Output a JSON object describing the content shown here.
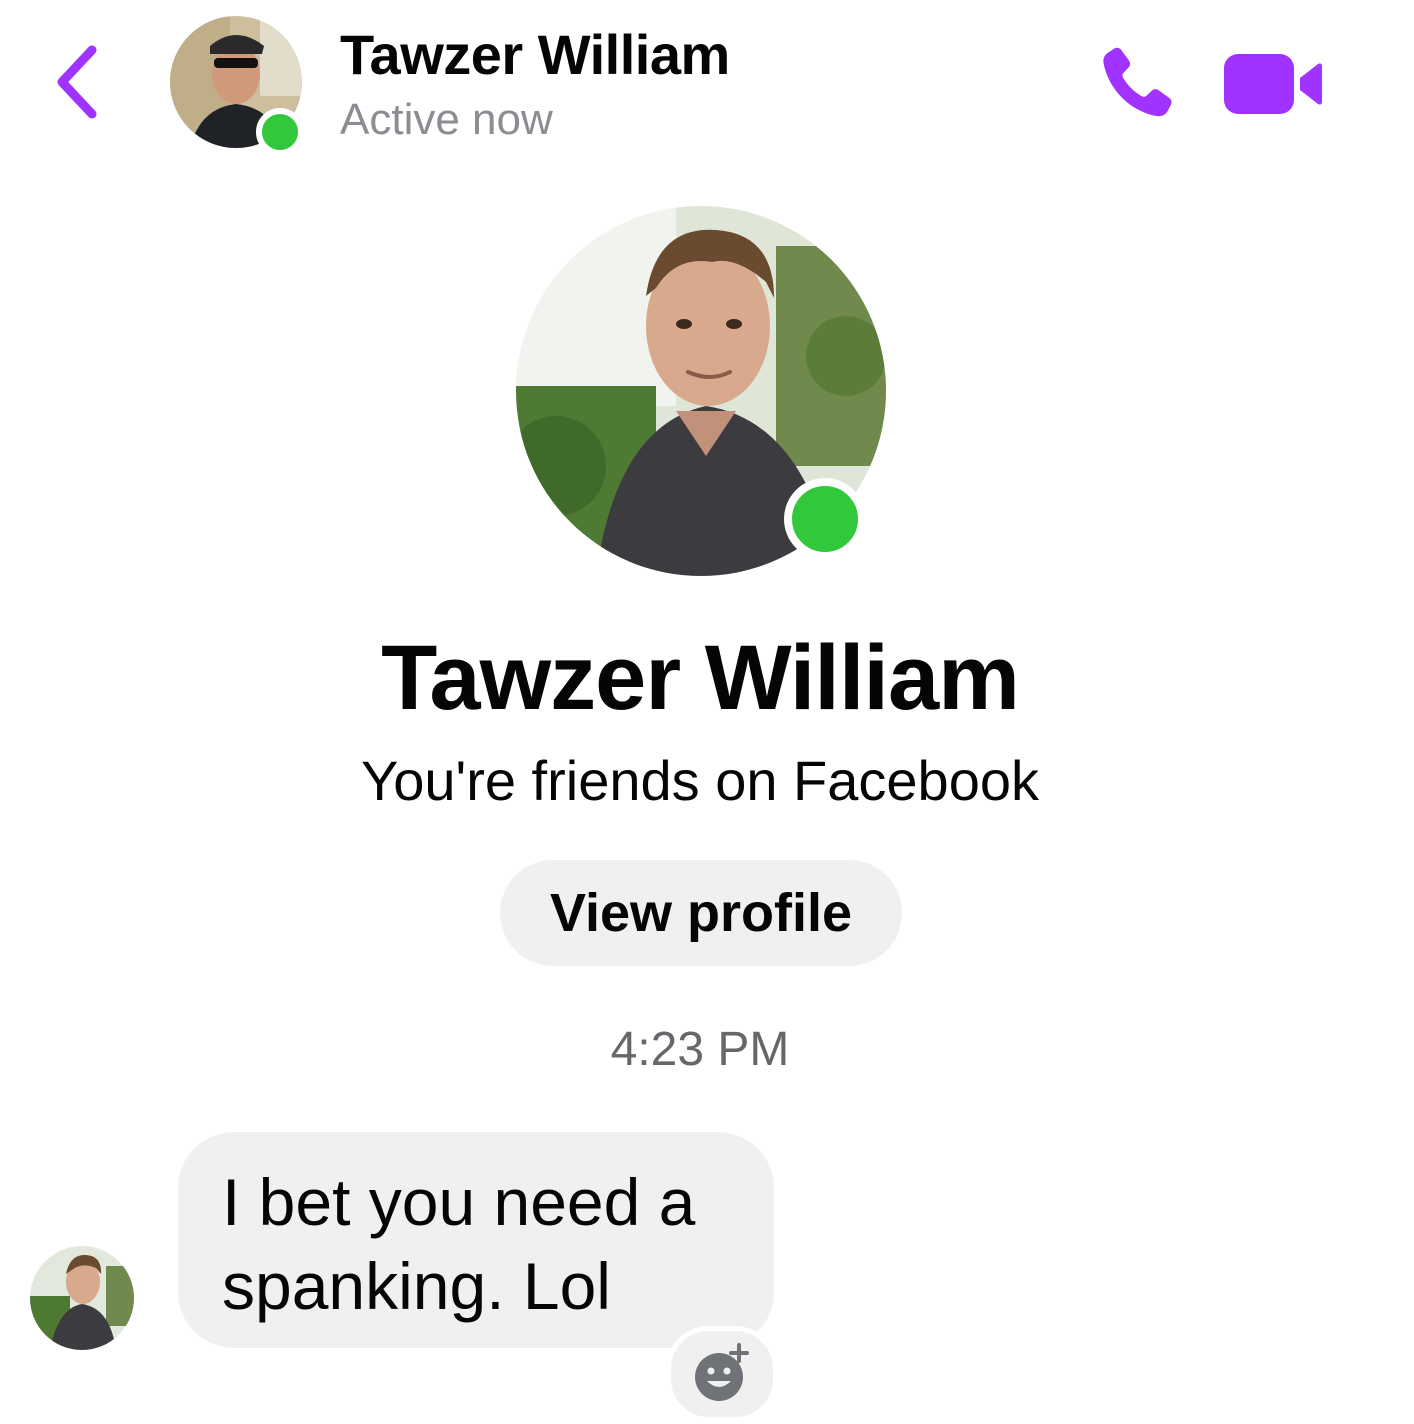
{
  "header": {
    "name": "Tawzer William",
    "status": "Active now",
    "back_icon": "chevron-left-icon",
    "call_icon": "phone-icon",
    "video_icon": "video-camera-icon"
  },
  "profile": {
    "name": "Tawzer William",
    "relationship": "You're friends on Facebook",
    "view_profile_label": "View profile"
  },
  "conversation": {
    "timestamp": "4:23 PM",
    "messages": [
      {
        "sender": "Tawzer William",
        "text": "I bet you need a spanking. Lol"
      }
    ]
  },
  "colors": {
    "accent": "#a033ff",
    "online": "#31c93b",
    "bubble": "#f0f0f0",
    "muted_text": "#8a8d91"
  }
}
